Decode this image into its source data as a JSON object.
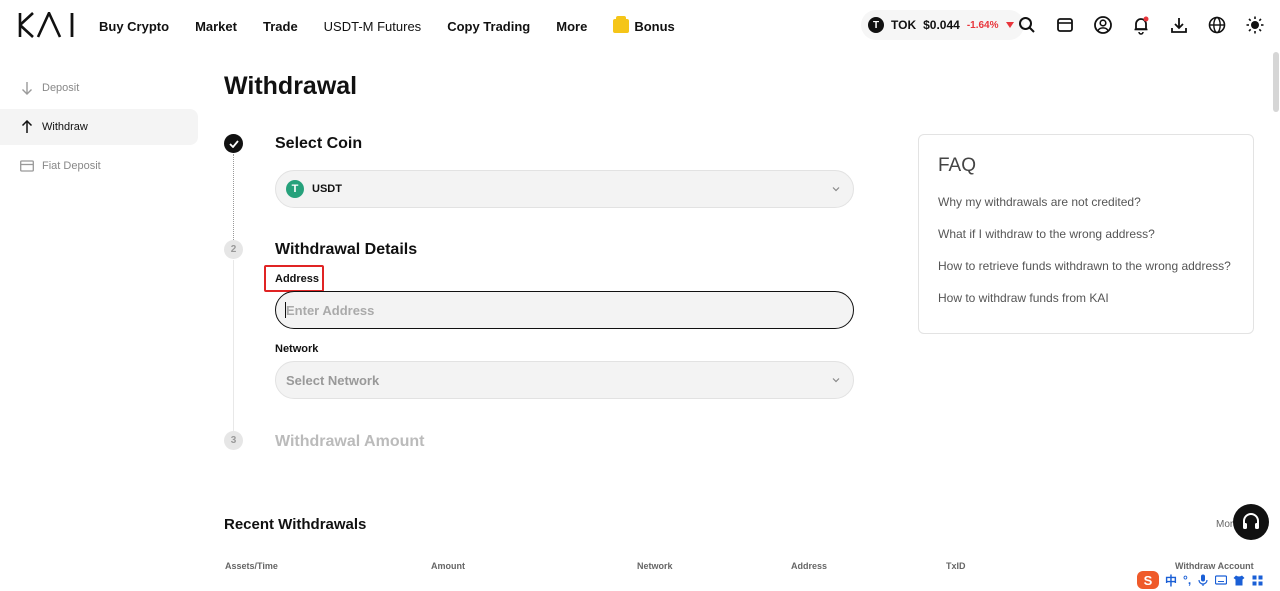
{
  "header": {
    "logo_text": "KAI",
    "nav": [
      "Buy Crypto",
      "Market",
      "Trade",
      "USDT-M Futures",
      "Copy Trading",
      "More"
    ],
    "bonus_label": "Bonus",
    "ticker": {
      "symbol": "TOK",
      "price": "$0.044",
      "change": "-1.64%",
      "change_color": "#e8353b"
    }
  },
  "sidebar": {
    "items": [
      {
        "label": "Deposit",
        "icon": "arrow-down-icon",
        "active": false
      },
      {
        "label": "Withdraw",
        "icon": "arrow-up-icon",
        "active": true
      },
      {
        "label": "Fiat Deposit",
        "icon": "card-icon",
        "active": false
      }
    ]
  },
  "main": {
    "title": "Withdrawal",
    "steps": {
      "step1": {
        "title": "Select Coin",
        "coin": "USDT",
        "coin_icon_letter": "T"
      },
      "step2": {
        "number": "2",
        "title": "Withdrawal Details",
        "address_label": "Address",
        "address_placeholder": "Enter Address",
        "address_value": "",
        "network_label": "Network",
        "network_placeholder": "Select Network"
      },
      "step3": {
        "number": "3",
        "title": "Withdrawal Amount"
      }
    }
  },
  "faq": {
    "title": "FAQ",
    "items": [
      "Why my withdrawals are not credited?",
      "What if I withdraw to the wrong address?",
      "How to retrieve funds withdrawn to the wrong address?",
      "How to withdraw funds from KAI"
    ]
  },
  "recent": {
    "title": "Recent Withdrawals",
    "more_label": "More",
    "columns": [
      "Assets/Time",
      "Amount",
      "Network",
      "Address",
      "TxID",
      "Withdraw Account"
    ]
  },
  "ime": {
    "lang": "中",
    "punct": "°,"
  }
}
